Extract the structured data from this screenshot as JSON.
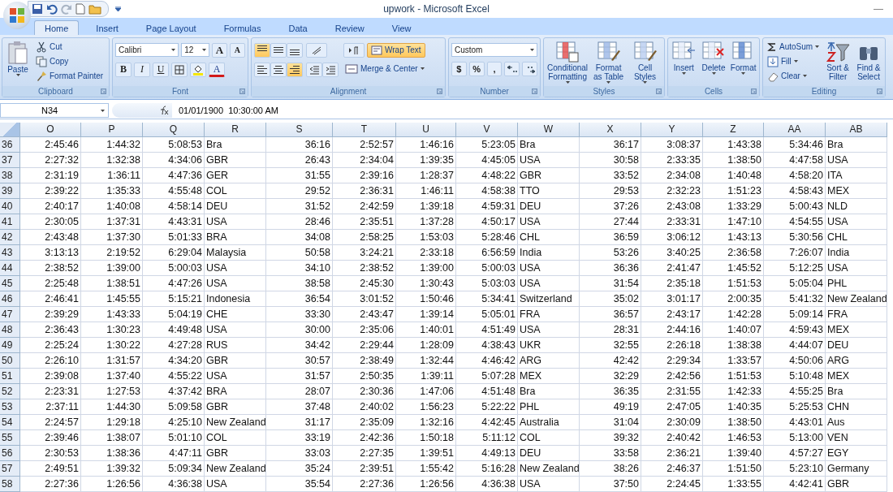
{
  "window": {
    "title": "upwork - Microsoft Excel"
  },
  "tabs": [
    {
      "label": "Home",
      "selected": true
    },
    {
      "label": "Insert",
      "selected": false
    },
    {
      "label": "Page Layout",
      "selected": false
    },
    {
      "label": "Formulas",
      "selected": false
    },
    {
      "label": "Data",
      "selected": false
    },
    {
      "label": "Review",
      "selected": false
    },
    {
      "label": "View",
      "selected": false
    }
  ],
  "clipboard": {
    "label": "Clipboard",
    "paste": "Paste",
    "items": [
      {
        "kind": "cut",
        "label": "Cut"
      },
      {
        "kind": "copy",
        "label": "Copy"
      },
      {
        "kind": "painter",
        "label": "Format Painter"
      }
    ]
  },
  "font": {
    "label": "Font",
    "name": "Calibri",
    "size": "12",
    "grow": "A",
    "shrink": "A",
    "styles": [
      {
        "kind": "bold",
        "label": "B"
      },
      {
        "kind": "italic",
        "label": "I"
      },
      {
        "kind": "underline",
        "label": "U"
      }
    ],
    "color_label": "A"
  },
  "alignment": {
    "label": "Alignment",
    "buttons": [
      {
        "kind": "top",
        "on": true
      },
      {
        "kind": "middle",
        "on": false
      },
      {
        "kind": "bottom",
        "on": false
      },
      {
        "kind": "left",
        "on": false
      },
      {
        "kind": "center",
        "on": false
      },
      {
        "kind": "right",
        "on": true
      }
    ],
    "wrap_text": {
      "label": "Wrap Text",
      "on": true
    },
    "merge": "Merge & Center"
  },
  "number": {
    "label": "Number",
    "format": "Custom",
    "symbols": [
      "$",
      "%",
      ","
    ]
  },
  "styles": {
    "label": "Styles",
    "buttons": [
      {
        "kind": "conditional",
        "label": "Conditional Formatting"
      },
      {
        "kind": "table",
        "label": "Format as Table"
      },
      {
        "kind": "cellstyles",
        "label": "Cell Styles"
      }
    ]
  },
  "cells": {
    "label": "Cells",
    "buttons": [
      {
        "kind": "insert",
        "label": "Insert"
      },
      {
        "kind": "delete",
        "label": "Delete"
      },
      {
        "kind": "format",
        "label": "Format"
      }
    ]
  },
  "editing": {
    "label": "Editing",
    "items": [
      {
        "kind": "sum",
        "label": "AutoSum"
      },
      {
        "kind": "fill",
        "label": "Fill"
      },
      {
        "kind": "clear",
        "label": "Clear"
      }
    ],
    "buttons": [
      {
        "kind": "sort",
        "label": "Sort & Filter"
      },
      {
        "kind": "find",
        "label": "Find & Select"
      }
    ]
  },
  "formula_bar": {
    "name_box": "N34",
    "value": "01/01/1900  10:30:00 AM"
  },
  "sheet": {
    "columns": [
      {
        "label": "O",
        "kind": "num"
      },
      {
        "label": "P",
        "kind": "num"
      },
      {
        "label": "Q",
        "kind": "num"
      },
      {
        "label": "R",
        "kind": "text"
      },
      {
        "label": "S",
        "kind": "num"
      },
      {
        "label": "T",
        "kind": "num"
      },
      {
        "label": "U",
        "kind": "num"
      },
      {
        "label": "V",
        "kind": "num"
      },
      {
        "label": "W",
        "kind": "text"
      },
      {
        "label": "X",
        "kind": "num"
      },
      {
        "label": "Y",
        "kind": "num"
      },
      {
        "label": "Z",
        "kind": "num"
      },
      {
        "label": "AA",
        "kind": "num"
      },
      {
        "label": "AB",
        "kind": "text"
      }
    ],
    "rows": [
      {
        "number": "36",
        "cells": [
          "2:45:46",
          "1:44:32",
          "5:08:53",
          "Bra",
          "36:16",
          "2:52:57",
          "1:46:16",
          "5:23:05",
          "Bra",
          "36:17",
          "3:08:37",
          "1:43:38",
          "5:34:46",
          "Bra"
        ]
      },
      {
        "number": "37",
        "cells": [
          "2:27:32",
          "1:32:38",
          "4:34:06",
          "GBR",
          "26:43",
          "2:34:04",
          "1:39:35",
          "4:45:05",
          "USA",
          "30:58",
          "2:33:35",
          "1:38:50",
          "4:47:58",
          "USA"
        ]
      },
      {
        "number": "38",
        "cells": [
          "2:31:19",
          "1:36:11",
          "4:47:36",
          "GER",
          "31:55",
          "2:39:16",
          "1:28:37",
          "4:48:22",
          "GBR",
          "33:52",
          "2:34:08",
          "1:40:48",
          "4:58:20",
          "ITA"
        ]
      },
      {
        "number": "39",
        "cells": [
          "2:39:22",
          "1:35:33",
          "4:55:48",
          "COL",
          "29:52",
          "2:36:31",
          "1:46:11",
          "4:58:38",
          "TTO",
          "29:53",
          "2:32:23",
          "1:51:23",
          "4:58:43",
          "MEX"
        ]
      },
      {
        "number": "40",
        "cells": [
          "2:40:17",
          "1:40:08",
          "4:58:14",
          "DEU",
          "31:52",
          "2:42:59",
          "1:39:18",
          "4:59:31",
          "DEU",
          "37:26",
          "2:43:08",
          "1:33:29",
          "5:00:43",
          "NLD"
        ]
      },
      {
        "number": "41",
        "cells": [
          "2:30:05",
          "1:37:31",
          "4:43:31",
          "USA",
          "28:46",
          "2:35:51",
          "1:37:28",
          "4:50:17",
          "USA",
          "27:44",
          "2:33:31",
          "1:47:10",
          "4:54:55",
          "USA"
        ]
      },
      {
        "number": "42",
        "cells": [
          "2:43:48",
          "1:37:30",
          "5:01:33",
          "BRA",
          "34:08",
          "2:58:25",
          "1:53:03",
          "5:28:46",
          "CHL",
          "36:59",
          "3:06:12",
          "1:43:13",
          "5:30:56",
          "CHL"
        ]
      },
      {
        "number": "43",
        "cells": [
          "3:13:13",
          "2:19:52",
          "6:29:04",
          "Malaysia",
          "50:58",
          "3:24:21",
          "2:33:18",
          "6:56:59",
          "India",
          "53:26",
          "3:40:25",
          "2:36:58",
          "7:26:07",
          "India"
        ]
      },
      {
        "number": "44",
        "cells": [
          "2:38:52",
          "1:39:00",
          "5:00:03",
          "USA",
          "34:10",
          "2:38:52",
          "1:39:00",
          "5:00:03",
          "USA",
          "36:36",
          "2:41:47",
          "1:45:52",
          "5:12:25",
          "USA"
        ]
      },
      {
        "number": "45",
        "cells": [
          "2:25:48",
          "1:38:51",
          "4:47:26",
          "USA",
          "38:58",
          "2:45:30",
          "1:30:43",
          "5:03:03",
          "USA",
          "31:54",
          "2:35:18",
          "1:51:53",
          "5:05:04",
          "PHL"
        ]
      },
      {
        "number": "46",
        "cells": [
          "2:46:41",
          "1:45:55",
          "5:15:21",
          "Indonesia",
          "36:54",
          "3:01:52",
          "1:50:46",
          "5:34:41",
          "Switzerland",
          "35:02",
          "3:01:17",
          "2:00:35",
          "5:41:32",
          "New Zealand"
        ]
      },
      {
        "number": "47",
        "cells": [
          "2:39:29",
          "1:43:33",
          "5:04:19",
          "CHE",
          "33:30",
          "2:43:47",
          "1:39:14",
          "5:05:01",
          "FRA",
          "36:57",
          "2:43:17",
          "1:42:28",
          "5:09:14",
          "FRA"
        ]
      },
      {
        "number": "48",
        "cells": [
          "2:36:43",
          "1:30:23",
          "4:49:48",
          "USA",
          "30:00",
          "2:35:06",
          "1:40:01",
          "4:51:49",
          "USA",
          "28:31",
          "2:44:16",
          "1:40:07",
          "4:59:43",
          "MEX"
        ]
      },
      {
        "number": "49",
        "cells": [
          "2:25:24",
          "1:30:22",
          "4:27:28",
          "RUS",
          "34:42",
          "2:29:44",
          "1:28:09",
          "4:38:43",
          "UKR",
          "32:55",
          "2:26:18",
          "1:38:38",
          "4:44:07",
          "DEU"
        ]
      },
      {
        "number": "50",
        "cells": [
          "2:26:10",
          "1:31:57",
          "4:34:20",
          "GBR",
          "30:57",
          "2:38:49",
          "1:32:44",
          "4:46:42",
          "ARG",
          "42:42",
          "2:29:34",
          "1:33:57",
          "4:50:06",
          "ARG"
        ]
      },
      {
        "number": "51",
        "cells": [
          "2:39:08",
          "1:37:40",
          "4:55:22",
          "USA",
          "31:57",
          "2:50:35",
          "1:39:11",
          "5:07:28",
          "MEX",
          "32:29",
          "2:42:56",
          "1:51:53",
          "5:10:48",
          "MEX"
        ]
      },
      {
        "number": "52",
        "cells": [
          "2:23:31",
          "1:27:53",
          "4:37:42",
          "BRA",
          "28:07",
          "2:30:36",
          "1:47:06",
          "4:51:48",
          "Bra",
          "36:35",
          "2:31:55",
          "1:42:33",
          "4:55:25",
          "Bra"
        ]
      },
      {
        "number": "53",
        "cells": [
          "2:37:11",
          "1:44:30",
          "5:09:58",
          "GBR",
          "37:48",
          "2:40:02",
          "1:56:23",
          "5:22:22",
          "PHL",
          "49:19",
          "2:47:05",
          "1:40:35",
          "5:25:53",
          "CHN"
        ]
      },
      {
        "number": "54",
        "cells": [
          "2:24:57",
          "1:29:18",
          "4:25:10",
          "New Zealand",
          "31:17",
          "2:35:09",
          "1:32:16",
          "4:42:45",
          "Australia",
          "31:04",
          "2:30:09",
          "1:38:50",
          "4:43:01",
          "Aus"
        ]
      },
      {
        "number": "55",
        "cells": [
          "2:39:46",
          "1:38:07",
          "5:01:10",
          "COL",
          "33:19",
          "2:42:36",
          "1:50:18",
          "5:11:12",
          "COL",
          "39:32",
          "2:40:42",
          "1:46:53",
          "5:13:00",
          "VEN"
        ]
      },
      {
        "number": "56",
        "cells": [
          "2:30:53",
          "1:38:36",
          "4:47:11",
          "GBR",
          "33:03",
          "2:27:35",
          "1:39:51",
          "4:49:13",
          "DEU",
          "33:58",
          "2:36:21",
          "1:39:40",
          "4:57:27",
          "EGY"
        ]
      },
      {
        "number": "57",
        "cells": [
          "2:49:51",
          "1:39:32",
          "5:09:34",
          "New Zealand",
          "35:24",
          "2:39:51",
          "1:55:42",
          "5:16:28",
          "New Zealand",
          "38:26",
          "2:46:37",
          "1:51:50",
          "5:23:10",
          "Germany"
        ]
      },
      {
        "number": "58",
        "cells": [
          "2:27:36",
          "1:26:56",
          "4:36:38",
          "USA",
          "35:54",
          "2:27:36",
          "1:26:56",
          "4:36:38",
          "USA",
          "37:50",
          "2:24:45",
          "1:33:55",
          "4:42:41",
          "GBR"
        ]
      }
    ]
  }
}
